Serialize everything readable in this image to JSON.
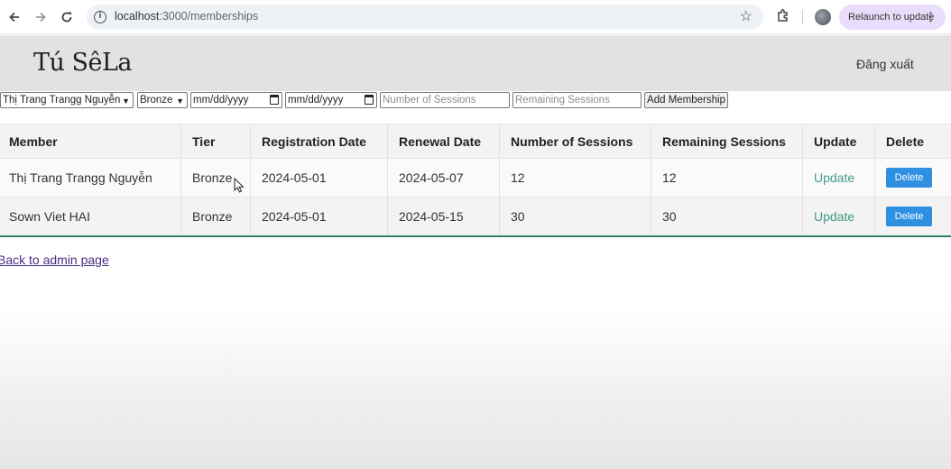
{
  "browser": {
    "url_host": "localhost",
    "url_path": ":3000/memberships",
    "relaunch_label": "Relaunch to update"
  },
  "header": {
    "logo": "Tú SêLa",
    "logout": "Đăng xuất"
  },
  "form": {
    "member_select": "Thị Trang Trangg Nguyễn",
    "tier_select": "Bronze",
    "registration_date": "mm/dd/yyyy",
    "renewal_date": "mm/dd/yyyy",
    "sessions_placeholder": "Number of Sessions",
    "remaining_placeholder": "Remaining Sessions",
    "add_button": "Add Membership"
  },
  "table": {
    "headers": [
      "Member",
      "Tier",
      "Registration Date",
      "Renewal Date",
      "Number of Sessions",
      "Remaining Sessions",
      "Update",
      "Delete"
    ],
    "rows": [
      {
        "member": "Thị Trang Trangg Nguyễn",
        "tier": "Bronze",
        "registration": "2024-05-01",
        "renewal": "2024-05-07",
        "sessions": "12",
        "remaining": "12",
        "update": "Update",
        "delete": "Delete"
      },
      {
        "member": "Sown Viet HAI",
        "tier": "Bronze",
        "registration": "2024-05-01",
        "renewal": "2024-05-15",
        "sessions": "30",
        "remaining": "30",
        "update": "Update",
        "delete": "Delete"
      }
    ]
  },
  "footer": {
    "back_link": "Back to admin page"
  },
  "icons": {
    "back": "arrow-left-icon",
    "forward": "arrow-right-icon",
    "reload": "reload-icon",
    "info": "info-icon",
    "bookmark": "star-icon",
    "extensions": "puzzle-icon",
    "menu": "kebab-menu-icon"
  },
  "colors": {
    "update_link": "#3e9b86",
    "delete_button": "#2f8fe0",
    "table_border": "#2f7c6a",
    "relaunch_bg": "#e9ddfb"
  }
}
